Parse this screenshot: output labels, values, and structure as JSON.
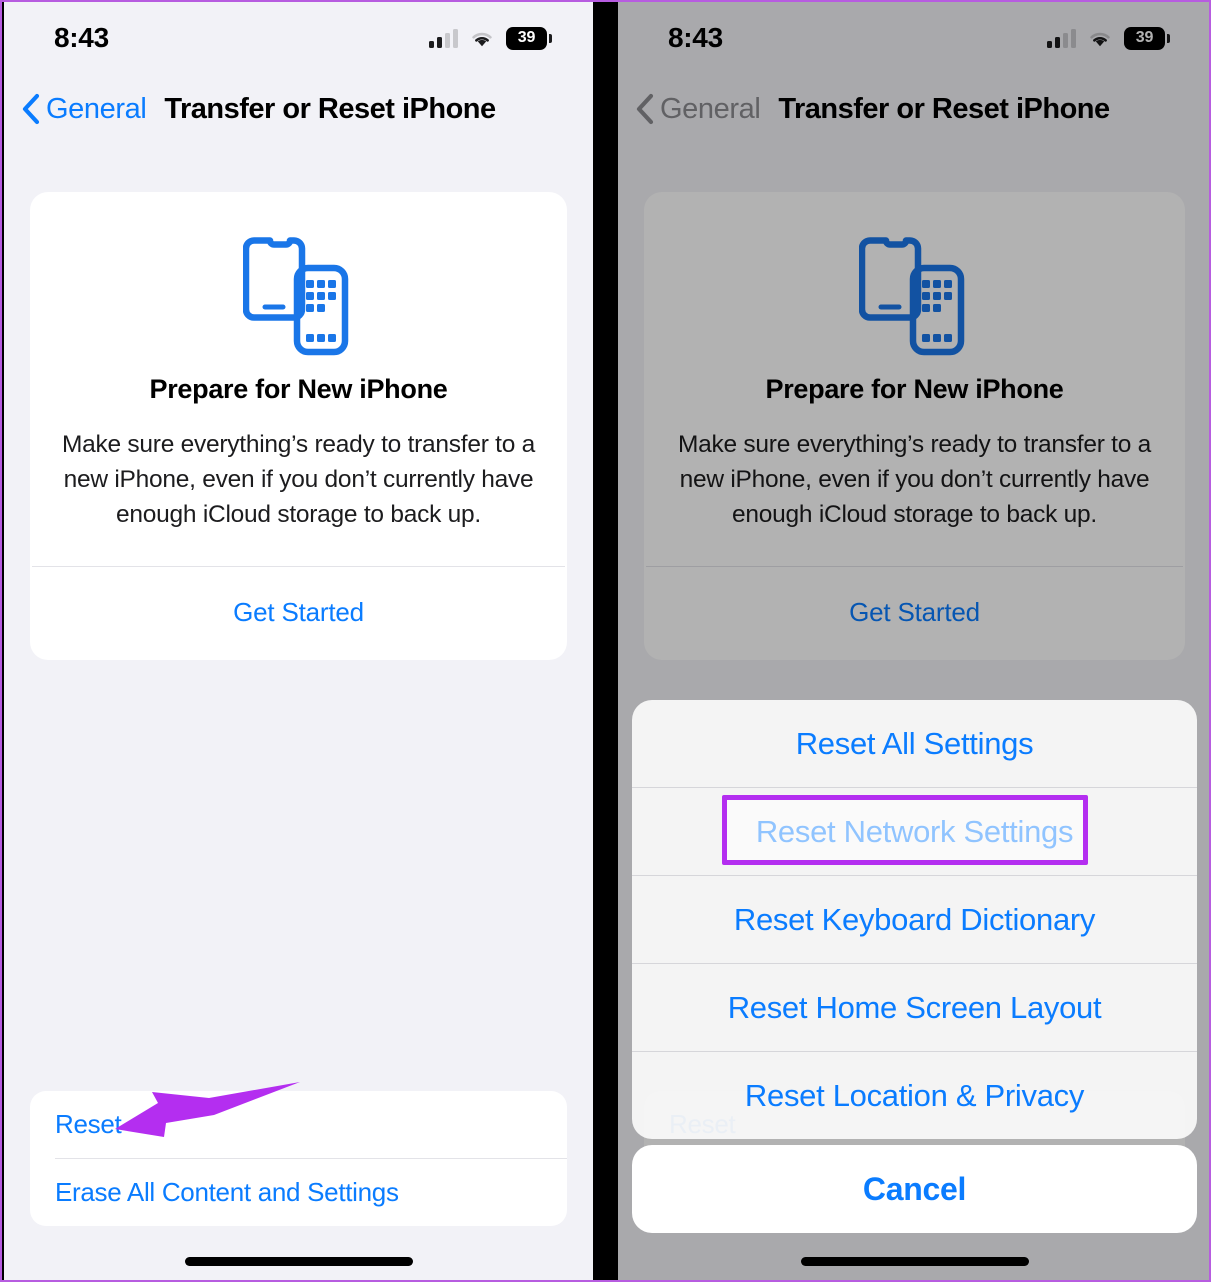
{
  "status_bar": {
    "time": "8:43",
    "battery_level": "39",
    "cellular_icon": "cellular-bars-icon",
    "wifi_icon": "wifi-icon",
    "battery_icon": "battery-icon"
  },
  "nav": {
    "back_icon": "chevron-left-icon",
    "back_label": "General",
    "title": "Transfer or Reset iPhone"
  },
  "prepare_card": {
    "illustration_icon": "two-iphones-icon",
    "title": "Prepare for New iPhone",
    "description": "Make sure everything’s ready to transfer to a new iPhone, even if you don’t currently have enough iCloud storage to back up.",
    "action_label": "Get Started"
  },
  "bottom_list": {
    "items": [
      {
        "label": "Reset"
      },
      {
        "label": "Erase All Content and Settings"
      }
    ]
  },
  "action_sheet": {
    "items": [
      {
        "label": "Reset All Settings",
        "highlighted": false
      },
      {
        "label": "Reset Network Settings",
        "highlighted": true
      },
      {
        "label": "Reset Keyboard Dictionary",
        "highlighted": false
      },
      {
        "label": "Reset Home Screen Layout",
        "highlighted": false
      },
      {
        "label": "Reset Location & Privacy",
        "highlighted": false
      }
    ],
    "cancel_label": "Cancel"
  },
  "annotations": {
    "arrow_icon": "arrow-left-annotation",
    "arrow_color": "#b42ef0",
    "highlight_color": "#b42ef0",
    "highlight_target": "Reset Network Settings"
  },
  "colors": {
    "accent_blue": "#0a7cff",
    "background": "#f2f2f7",
    "card": "#ffffff",
    "annotation_purple": "#b42ef0",
    "divider_black": "#000000"
  }
}
